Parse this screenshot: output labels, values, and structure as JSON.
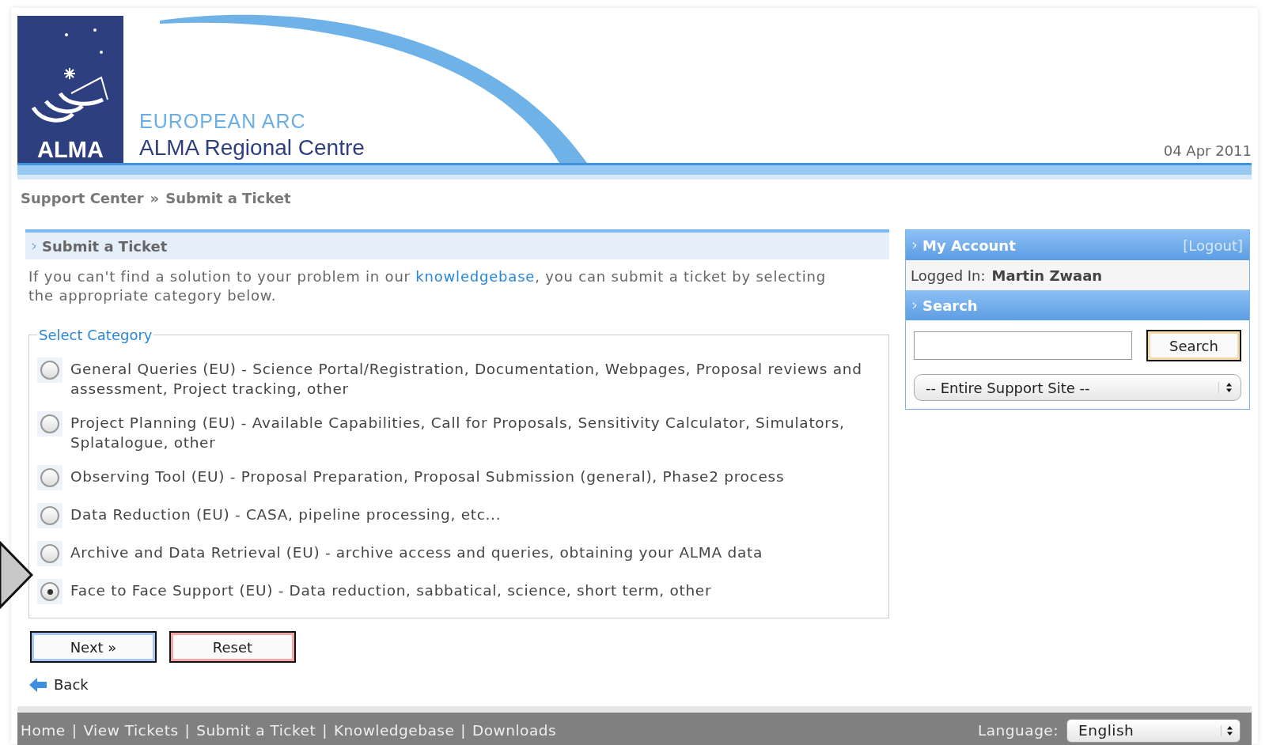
{
  "header": {
    "logo_text": "ALMA",
    "subtitle": "EUROPEAN ARC",
    "title": "ALMA Regional Centre",
    "date": "04 Apr 2011"
  },
  "breadcrumb": {
    "items": [
      "Support Center",
      "Submit a Ticket"
    ],
    "separator": "»"
  },
  "main": {
    "heading": "Submit a Ticket",
    "intro_before": "If you can't find a solution to your problem in our ",
    "intro_link": "knowledgebase",
    "intro_after": ", you can submit a ticket by selecting the appropriate category below.",
    "legend": "Select Category",
    "categories": [
      {
        "label": "General Queries (EU) - Science Portal/Registration, Documentation, Webpages, Proposal reviews and assessment, Project tracking, other",
        "selected": false
      },
      {
        "label": "Project Planning (EU) - Available Capabilities, Call for Proposals, Sensitivity Calculator, Simulators, Splatalogue, other",
        "selected": false
      },
      {
        "label": "Observing Tool (EU) - Proposal Preparation, Proposal Submission (general), Phase2 process",
        "selected": false
      },
      {
        "label": "Data Reduction (EU) - CASA, pipeline processing, etc...",
        "selected": false
      },
      {
        "label": "Archive and Data Retrieval (EU) - archive access and queries, obtaining your ALMA data",
        "selected": false
      },
      {
        "label": "Face to Face Support (EU) - Data reduction, sabbatical, science, short term, other",
        "selected": true
      }
    ],
    "next": "Next »",
    "reset": "Reset",
    "back": "Back"
  },
  "sidebar": {
    "account_title": "My Account",
    "logout": "[Logout]",
    "logged_in_label": "Logged In:",
    "user": "Martin Zwaan",
    "search_title": "Search",
    "search_button": "Search",
    "scope": "-- Entire Support Site --"
  },
  "footer": {
    "links": [
      "Home",
      "View Tickets",
      "Submit a Ticket",
      "Knowledgebase",
      "Downloads"
    ],
    "separator": "|",
    "language_label": "Language:",
    "language": "English"
  }
}
